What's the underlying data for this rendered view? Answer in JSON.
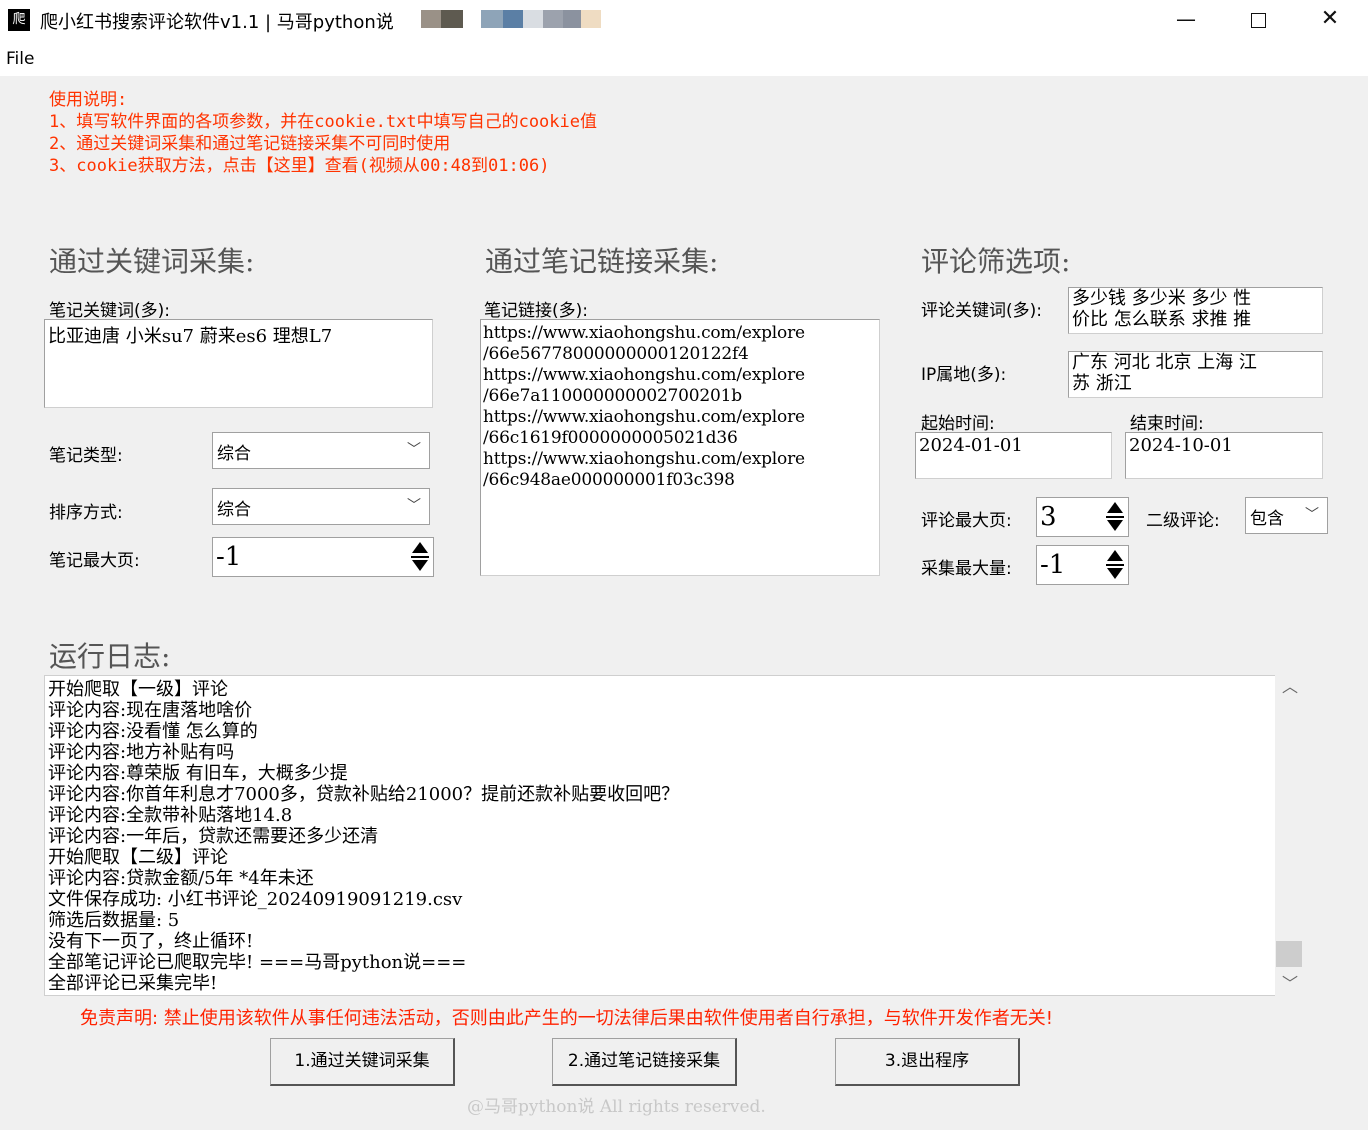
{
  "window": {
    "title": "爬小红书搜索评论软件v1.1 | 马哥python说",
    "icon_text": "爬",
    "minimize_glyph": "—",
    "close_glyph": "✕",
    "title_colors": [
      "#9a9187",
      "#5e5a50",
      "#8ea4b8",
      "#5b7fa5",
      "#d9dde2",
      "#9ca2ad",
      "#8b929f",
      "#efdcc2"
    ]
  },
  "menu": {
    "file": "File"
  },
  "instructions": {
    "title": "使用说明:",
    "line1": "1、填写软件界面的各项参数，并在cookie.txt中填写自己的cookie值",
    "line2": "2、通过关键词采集和通过笔记链接采集不可同时使用",
    "line3": "3、cookie获取方法，点击【这里】查看(视频从00:48到01:06)"
  },
  "keyword_section": {
    "heading": "通过关键词采集:",
    "keywords_label": "笔记关键词(多):",
    "keywords_value": "比亚迪唐 小米su7 蔚来es6 理想L7",
    "note_type_label": "笔记类型:",
    "note_type_value": "综合",
    "sort_label": "排序方式:",
    "sort_value": "综合",
    "max_page_label": "笔记最大页:",
    "max_page_value": "-1"
  },
  "link_section": {
    "heading": "通过笔记链接采集:",
    "links_label": "笔记链接(多):",
    "links": [
      "https://www.xiaohongshu.com/explore",
      "/66e56778000000000120122f4",
      "https://www.xiaohongshu.com/explore",
      "/66e7a110000000002700201b",
      "https://www.xiaohongshu.com/explore",
      "/66c1619f0000000005021d36",
      "https://www.xiaohongshu.com/explore",
      "/66c948ae000000001f03c398"
    ]
  },
  "filter_section": {
    "heading": "评论筛选项:",
    "comment_keywords_label": "评论关键词(多):",
    "comment_keywords_line1": "多少钱 多少米 多少 性",
    "comment_keywords_line2": "价比 怎么联系 求推 推",
    "ip_label": "IP属地(多):",
    "ip_line1": "广东 河北 北京 上海 江",
    "ip_line2": "苏 浙江",
    "start_label": "起始时间:",
    "start_value": "2024-01-01",
    "end_label": "结束时间:",
    "end_value": "2024-10-01",
    "comment_max_page_label": "评论最大页:",
    "comment_max_page_value": "3",
    "second_level_label": "二级评论:",
    "second_level_value": "包含",
    "max_count_label": "采集最大量:",
    "max_count_value": "-1"
  },
  "log": {
    "heading": "运行日志:",
    "lines": [
      "开始爬取【一级】评论",
      "评论内容:现在唐落地啥价",
      "评论内容:没看懂 怎么算的",
      "评论内容:地方补贴有吗",
      "评论内容:尊荣版 有旧车，大概多少提",
      "评论内容:你首年利息才7000多，贷款补贴给21000？提前还款补贴要收回吧？",
      "评论内容:全款带补贴落地14.8",
      "评论内容:一年后，贷款还需要还多少还清",
      "开始爬取【二级】评论",
      "评论内容:贷款金额/5年 *4年未还",
      "文件保存成功: 小红书评论_20240919091219.csv",
      "筛选后数据量: 5",
      "没有下一页了，终止循环!",
      "全部笔记评论已爬取完毕! ===马哥python说===",
      "全部评论已采集完毕!"
    ]
  },
  "disclaimer": "免责声明: 禁止使用该软件从事任何违法活动，否则由此产生的一切法律后果由软件使用者自行承担，与软件开发作者无关!",
  "buttons": {
    "keyword": "1.通过关键词采集",
    "link": "2.通过笔记链接采集",
    "exit": "3.退出程序"
  },
  "footer": "@马哥python说 All rights reserved."
}
